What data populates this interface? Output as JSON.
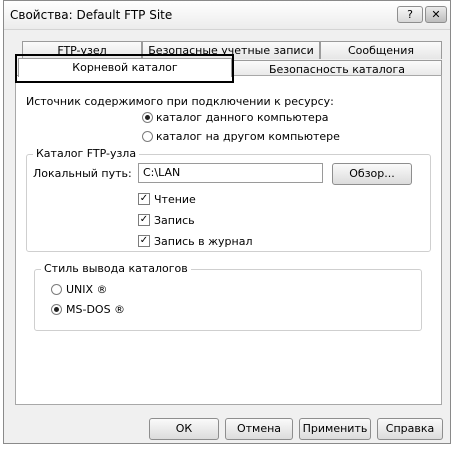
{
  "window": {
    "title": "Свойства: Default FTP Site",
    "help": "?",
    "close": "✕"
  },
  "tabs_back": [
    "FTP-узел",
    "Безопасные учетные записи",
    "Сообщения"
  ],
  "tabs_front": [
    "Корневой каталог",
    "Безопасность каталога"
  ],
  "content": {
    "source_label": "Источник содержимого при подключении к ресурсу:",
    "opt_local": "каталог данного компьютера",
    "opt_remote": "каталог на другом компьютере",
    "ftp_group": "Каталог FTP-узла",
    "local_path_label": "Локальный путь:",
    "local_path_value": "C:\\LAN",
    "browse": "Обзор...",
    "read": "Чтение",
    "write": "Запись",
    "log": "Запись в журнал",
    "style_group": "Стиль вывода каталогов",
    "unix": "UNIX ®",
    "msdos": "MS-DOS ®"
  },
  "buttons": {
    "ok": "ОК",
    "cancel": "Отмена",
    "apply": "Применить",
    "help": "Справка"
  }
}
